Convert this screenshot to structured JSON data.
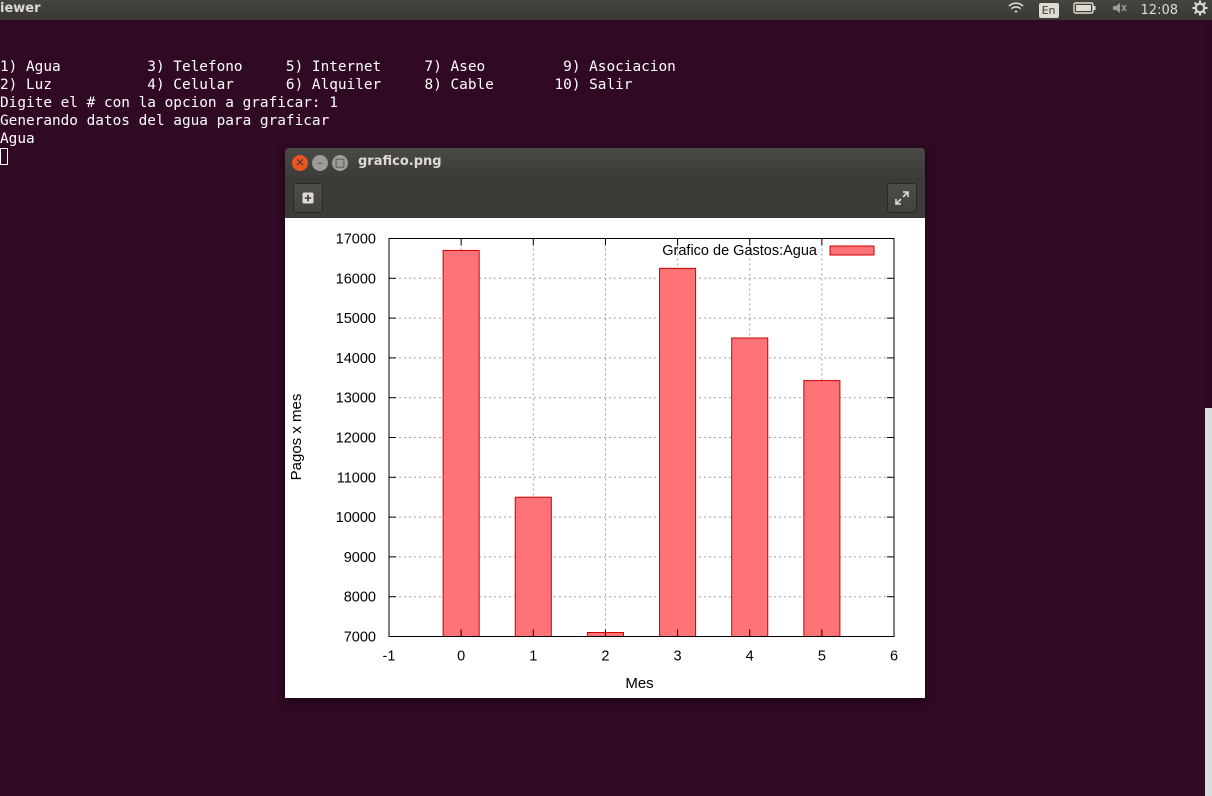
{
  "topbar": {
    "app_title": "iewer",
    "lang": "En",
    "time": "12:08"
  },
  "terminal": {
    "lines": [
      "1) Agua          3) Telefono     5) Internet     7) Aseo         9) Asociacion",
      "2) Luz           4) Celular      6) Alquiler     8) Cable       10) Salir",
      "Digite el # con la opcion a graficar: 1",
      "Generando datos del agua para graficar",
      "Agua"
    ]
  },
  "viewer": {
    "title": "grafico.png",
    "toolbar_left_icon": "plus-square-icon",
    "toolbar_right_icon": "fullscreen-icon"
  },
  "colors": {
    "terminal_bg": "#300a24",
    "bar_fill": "#ff7377",
    "bar_stroke": "#cc0000"
  },
  "chart_data": {
    "type": "bar",
    "title": "",
    "legend": "Grafico de Gastos:Agua",
    "legend_position": "top-right",
    "xlabel": "Mes",
    "ylabel": "Pagos x mes",
    "xlim": [
      -1,
      6
    ],
    "ylim": [
      7000,
      17000
    ],
    "x_ticks": [
      "-1",
      "0",
      "1",
      "2",
      "3",
      "4",
      "5",
      "6"
    ],
    "y_ticks": [
      "7000",
      "8000",
      "9000",
      "10000",
      "11000",
      "12000",
      "13000",
      "14000",
      "15000",
      "16000",
      "17000"
    ],
    "grid": true,
    "x": [
      0,
      1,
      2,
      3,
      4,
      5
    ],
    "values": [
      16700,
      10500,
      7100,
      16250,
      14500,
      13430
    ]
  }
}
